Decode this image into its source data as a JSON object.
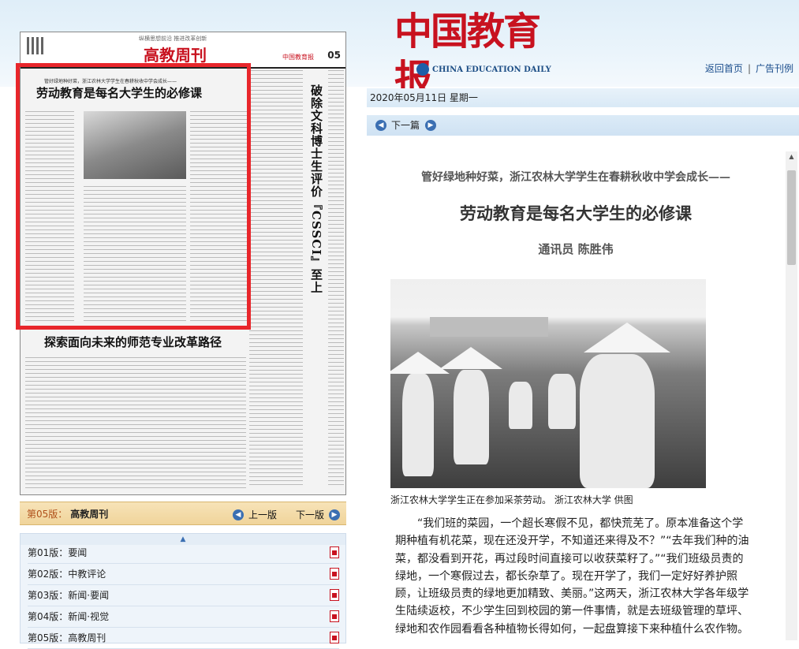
{
  "header": {
    "logo_cn": "中国教育报",
    "logo_en": "CHINA EDUCATION DAILY",
    "links": [
      "返回首页",
      "广告刊例"
    ]
  },
  "thumbnail": {
    "slogan": "纵横思想前沿 推进改革创新",
    "title_part1": "高教",
    "title_part2": "周刊",
    "edition_no": "05",
    "paper_logo": "中国教育报",
    "kicker": "管好绿地种好菜，浙江农林大学学生在春耕秋收中学会成长——",
    "headline": "劳动教育是每名大学生的必修课",
    "vertical_headline": "破除文科博士生评价『CSSCI』至上",
    "headline2": "探索面向未来的师范专业改革路径"
  },
  "edition_bar": {
    "label": "第05版：",
    "name": "高教周刊",
    "prev": "上一版",
    "next": "下一版"
  },
  "editions": [
    {
      "label": "第01版：要闻"
    },
    {
      "label": "第02版：中教评论"
    },
    {
      "label": "第03版：新闻·要闻"
    },
    {
      "label": "第04版：新闻·视觉"
    },
    {
      "label": "第05版：高教周刊"
    }
  ],
  "date_line": "2020年05月11日  星期一",
  "next_article": "下一篇",
  "article": {
    "kicker": "管好绿地种好菜，浙江农林大学学生在春耕秋收中学会成长——",
    "headline": "劳动教育是每名大学生的必修课",
    "byline": "通讯员  陈胜伟",
    "caption": "浙江农林大学学生正在参加采茶劳动。  浙江农林大学  供图",
    "body": "“我们班的菜园，一个超长寒假不见，都快荒芜了。原本准备这个学期种植有机花菜，现在还没开学，不知道还来得及不？”“去年我们种的油菜，都没看到开花，再过段时间直接可以收获菜籽了。”“我们班级员责的绿地，一个寒假过去，都长杂草了。现在开学了，我们一定好好养护照顾，让班级员责的绿地更加精致、美丽。”这两天，浙江农林大学各年级学生陆续返校，不少学生回到校园的第一件事情，就是去班级管理的草坪、绿地和农作园看看各种植物长得如何，一起盘算接下来种植什么农作物。"
  },
  "colors": {
    "brand_red": "#c8121f",
    "link_blue": "#1a4d8c",
    "highlight_frame": "#e8262b"
  }
}
